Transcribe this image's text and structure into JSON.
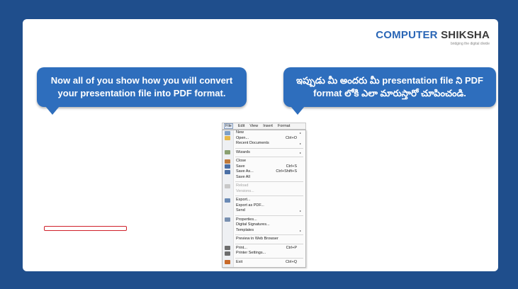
{
  "logo": {
    "name_part1": "COMPUTER ",
    "name_part2": "SHIKSHA",
    "tagline": "bridging the digital divide"
  },
  "bubble_left_text": "Now all of you show how you will convert your presentation file into PDF format.",
  "bubble_right_text": "ఇప్పుడు మీ అందరు మీ presentation file ని PDF format లోకి ఎలా మారుస్తారో చూపించండి.",
  "menubar": [
    "File",
    "Edit",
    "View",
    "Insert",
    "Format"
  ],
  "menu_items": [
    {
      "label": "New",
      "shortcut": "",
      "submenu": true,
      "icon": "new-document-icon",
      "color": "#7ea0c8",
      "disabled": false
    },
    {
      "label": "Open...",
      "shortcut": "Ctrl+O",
      "submenu": false,
      "icon": "folder-icon",
      "color": "#e6b84a",
      "disabled": false
    },
    {
      "label": "Recent Documents",
      "shortcut": "",
      "submenu": true,
      "icon": "",
      "color": "",
      "disabled": false
    },
    {
      "sep": true
    },
    {
      "label": "Wizards",
      "shortcut": "",
      "submenu": true,
      "icon": "wizard-icon",
      "color": "#8aa070",
      "disabled": false
    },
    {
      "sep": true
    },
    {
      "label": "Close",
      "shortcut": "",
      "submenu": false,
      "icon": "close-icon",
      "color": "#c07a3a",
      "disabled": false
    },
    {
      "label": "Save",
      "shortcut": "Ctrl+S",
      "submenu": false,
      "icon": "save-icon",
      "color": "#4a6fa5",
      "disabled": false
    },
    {
      "label": "Save As...",
      "shortcut": "Ctrl+Shift+S",
      "submenu": false,
      "icon": "save-as-icon",
      "color": "#4a6fa5",
      "disabled": false
    },
    {
      "label": "Save All",
      "shortcut": "",
      "submenu": false,
      "icon": "",
      "color": "",
      "disabled": false
    },
    {
      "sep": true
    },
    {
      "label": "Reload",
      "shortcut": "",
      "submenu": false,
      "icon": "reload-icon",
      "color": "#c8c8c8",
      "disabled": true
    },
    {
      "label": "Versions...",
      "shortcut": "",
      "submenu": false,
      "icon": "",
      "color": "",
      "disabled": true
    },
    {
      "sep": true
    },
    {
      "label": "Export...",
      "shortcut": "",
      "submenu": false,
      "icon": "export-icon",
      "color": "#6a8ab5",
      "disabled": false
    },
    {
      "label": "Export as PDF...",
      "shortcut": "",
      "submenu": false,
      "icon": "",
      "color": "",
      "disabled": false
    },
    {
      "label": "Send",
      "shortcut": "",
      "submenu": true,
      "icon": "",
      "color": "",
      "disabled": false
    },
    {
      "sep": true
    },
    {
      "label": "Properties...",
      "shortcut": "",
      "submenu": false,
      "icon": "properties-icon",
      "color": "#7890b0",
      "disabled": false
    },
    {
      "label": "Digital Signatures...",
      "shortcut": "",
      "submenu": false,
      "icon": "",
      "color": "",
      "disabled": false
    },
    {
      "label": "Templates",
      "shortcut": "",
      "submenu": true,
      "icon": "",
      "color": "",
      "disabled": false
    },
    {
      "sep": true
    },
    {
      "label": "Preview in Web Browser",
      "shortcut": "",
      "submenu": false,
      "icon": "",
      "color": "",
      "disabled": false
    },
    {
      "sep": true
    },
    {
      "label": "Print...",
      "shortcut": "Ctrl+P",
      "submenu": false,
      "icon": "printer-icon",
      "color": "#6d6d6d",
      "disabled": false
    },
    {
      "label": "Printer Settings...",
      "shortcut": "",
      "submenu": false,
      "icon": "printer-settings-icon",
      "color": "#6d6d6d",
      "disabled": false
    },
    {
      "sep": true
    },
    {
      "label": "Exit",
      "shortcut": "Ctrl+Q",
      "submenu": false,
      "icon": "exit-icon",
      "color": "#c86a2a",
      "disabled": false
    }
  ],
  "colors": {
    "background": "#1f4e8c",
    "bubble": "#2e6ebd",
    "highlight": "#d0202a"
  }
}
